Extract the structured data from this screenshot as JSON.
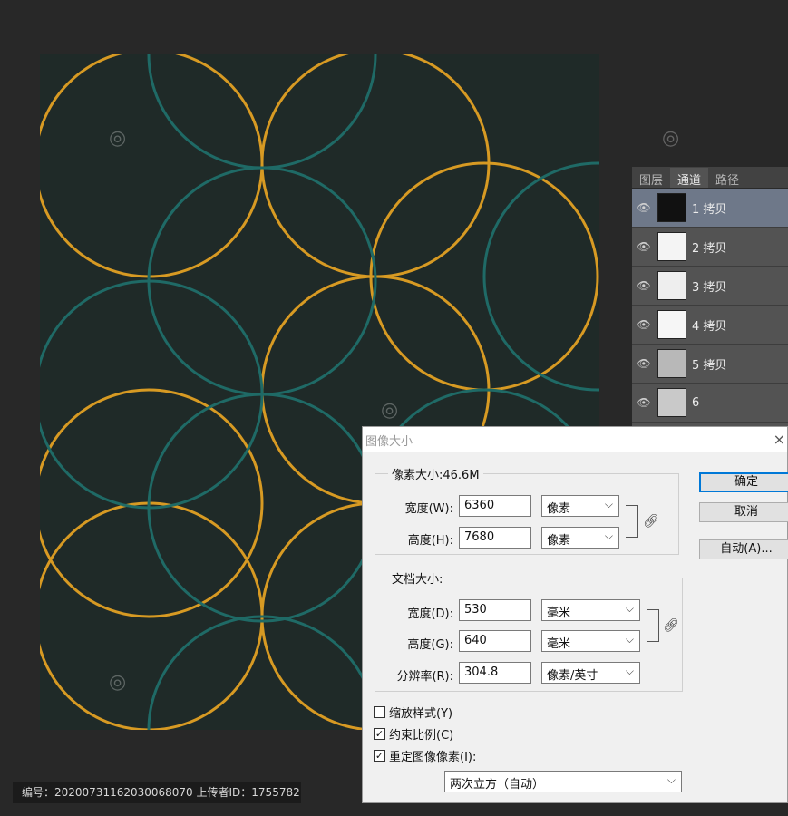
{
  "panel": {
    "tabs": [
      "图层",
      "通道",
      "路径"
    ],
    "active_tab": 1,
    "channels": [
      {
        "label": "1 拷贝"
      },
      {
        "label": "2 拷贝"
      },
      {
        "label": "3 拷贝"
      },
      {
        "label": "4 拷贝"
      },
      {
        "label": "5 拷贝"
      },
      {
        "label": "6"
      }
    ]
  },
  "dialog": {
    "title": "图像大小",
    "close_glyph": "×",
    "pixel_dimensions_label": "像素大小:46.6M",
    "pixel_width_label": "宽度(W):",
    "pixel_width_value": "6360",
    "pixel_width_unit": "像素",
    "pixel_height_label": "高度(H):",
    "pixel_height_value": "7680",
    "pixel_height_unit": "像素",
    "document_size_label": "文档大小:",
    "doc_width_label": "宽度(D):",
    "doc_width_value": "530",
    "doc_width_unit": "毫米",
    "doc_height_label": "高度(G):",
    "doc_height_value": "640",
    "doc_height_unit": "毫米",
    "resolution_label": "分辨率(R):",
    "resolution_value": "304.8",
    "resolution_unit": "像素/英寸",
    "ok_label": "确定",
    "cancel_label": "取消",
    "auto_label": "自动(A)...",
    "scale_styles_label": "缩放样式(Y)",
    "scale_styles_checked": false,
    "constrain_label": "约束比例(C)",
    "constrain_checked": true,
    "resample_label": "重定图像像素(I):",
    "resample_checked": true,
    "resample_method": "两次立方（自动）"
  },
  "footer": {
    "text": "编号：20200731162030068070 上传者ID：1755782"
  },
  "colors": {
    "gold": "#d79a23",
    "teal": "#1f6a66",
    "canvas_bg": "#1f2a28"
  }
}
